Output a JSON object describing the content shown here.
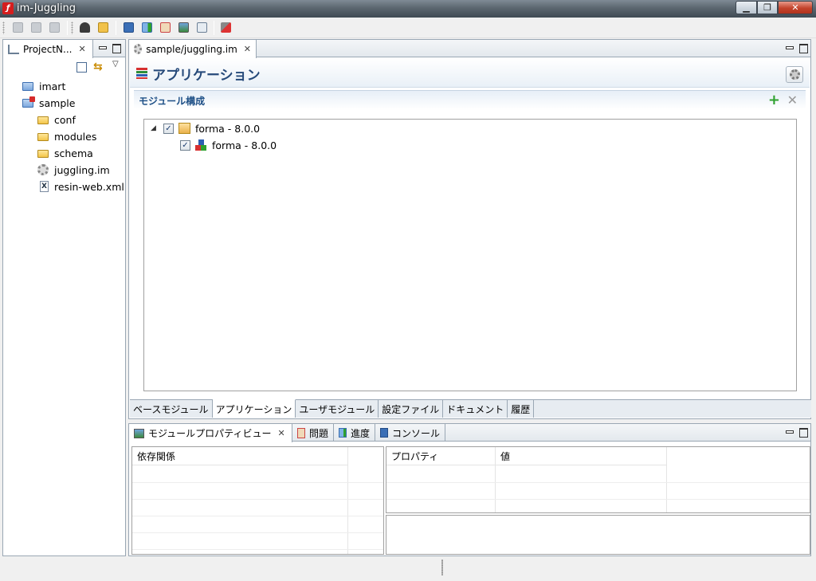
{
  "window": {
    "title": "im-Juggling"
  },
  "toolbar": {
    "icons": [
      "save-icon",
      "save-as-icon",
      "save-all-icon",
      "helmet-icon",
      "open-folder-icon",
      "monitor-icon",
      "run-icon",
      "person-icon",
      "image-icon",
      "tree-icon",
      "tools-icon"
    ]
  },
  "project_explorer": {
    "tab_label": "ProjectN...",
    "items": [
      {
        "label": "imart",
        "icon": "folder-blue-icon"
      },
      {
        "label": "sample",
        "icon": "project-folder-icon"
      },
      {
        "label": "conf",
        "icon": "folder-icon"
      },
      {
        "label": "modules",
        "icon": "folder-icon"
      },
      {
        "label": "schema",
        "icon": "folder-icon"
      },
      {
        "label": "juggling.im",
        "icon": "gear-file-icon"
      },
      {
        "label": "resin-web.xml",
        "icon": "xml-file-icon"
      }
    ]
  },
  "editor": {
    "tab_label": "sample/juggling.im",
    "title": "アプリケーション",
    "section_title": "モジュール構成",
    "tree": [
      {
        "label": "forma - 8.0.0",
        "checked": true
      },
      {
        "label": "forma - 8.0.0",
        "checked": true
      }
    ],
    "bottom_tabs": [
      "ベースモジュール",
      "アプリケーション",
      "ユーザモジュール",
      "設定ファイル",
      "ドキュメント",
      "履歴"
    ],
    "active_bottom_tab": "アプリケーション"
  },
  "bottom_panel": {
    "tabs": [
      {
        "label": "モジュールプロパティビュー",
        "active": true
      },
      {
        "label": "問題",
        "active": false
      },
      {
        "label": "進度",
        "active": false
      },
      {
        "label": "コンソール",
        "active": false
      }
    ],
    "dependency_header": "依存関係",
    "property_header": "プロパティ",
    "value_header": "値"
  },
  "colors": {
    "accent": "#264a7a",
    "section": "#1d4f86",
    "add": "#2ea12e",
    "close": "#c4432b"
  }
}
